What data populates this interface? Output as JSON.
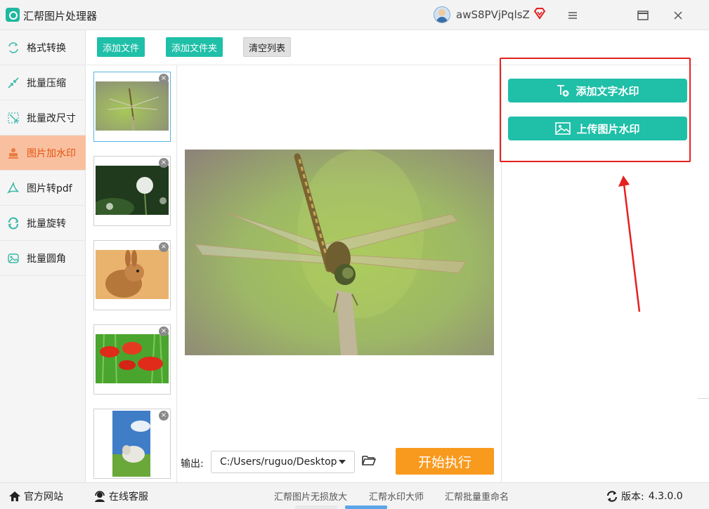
{
  "app": {
    "title": "汇帮图片处理器",
    "username": "awS8PVjPqlsZ"
  },
  "window_controls": {
    "menu": "≡",
    "minimize": "▭",
    "close": "✕"
  },
  "sidebar": {
    "items": [
      {
        "label": "格式转换",
        "icon": "format-convert-icon"
      },
      {
        "label": "批量压缩",
        "icon": "compress-icon"
      },
      {
        "label": "批量改尺寸",
        "icon": "resize-icon"
      },
      {
        "label": "图片加水印",
        "icon": "watermark-icon",
        "active": true
      },
      {
        "label": "图片转pdf",
        "icon": "pdf-icon"
      },
      {
        "label": "批量旋转",
        "icon": "rotate-icon"
      },
      {
        "label": "批量圆角",
        "icon": "round-corner-icon"
      }
    ]
  },
  "toolbar": {
    "add_file": "添加文件",
    "add_folder": "添加文件夹",
    "clear_list": "清空列表"
  },
  "thumbnails": [
    {
      "subject": "dragonfly",
      "selected": true
    },
    {
      "subject": "dandelion"
    },
    {
      "subject": "rabbit"
    },
    {
      "subject": "red-poppies"
    },
    {
      "subject": "sheep"
    }
  ],
  "watermark_panel": {
    "add_text_watermark": "添加文字水印",
    "upload_image_watermark": "上传图片水印"
  },
  "output": {
    "label": "输出:",
    "path": "C:/Users/ruguo/Desktop",
    "start_button": "开始执行"
  },
  "bottom_bar": {
    "official_site": "官方网站",
    "online_service": "在线客服",
    "links": [
      "汇帮图片无损放大",
      "汇帮水印大师",
      "汇帮批量重命名"
    ],
    "version_label": "版本:",
    "version": "4.3.0.0"
  },
  "colors": {
    "accent_teal": "#1fbfa8",
    "active_sidebar_bg": "#f9c09f",
    "active_sidebar_text": "#e5530f",
    "start_button": "#f89a1e",
    "highlight_red": "#e5201f"
  }
}
